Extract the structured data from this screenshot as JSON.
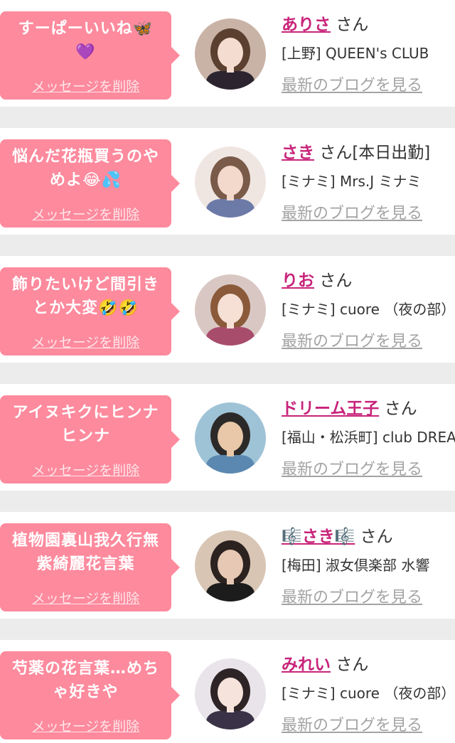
{
  "messages": [
    {
      "bubble": "すーぱーいいね🦋\n💜",
      "delete_label": "メッセージを削除",
      "cast_name": "ありさ",
      "honorific": "さん",
      "shop": "[上野] QUEEN's CLUB",
      "blog_link": "最新のブログを見る",
      "avatar_colors": {
        "bg": "#c9b3a6",
        "hair": "#5b4030",
        "skin": "#f4dcd0",
        "cloth": "#2c2530"
      }
    },
    {
      "bubble": "悩んだ花瓶買うのや\nめよ😂💦",
      "delete_label": "メッセージを削除",
      "cast_name": "さき",
      "honorific": "さん[本日出勤]",
      "shop": "[ミナミ] Mrs.J ミナミ",
      "blog_link": "最新のブログを見る",
      "avatar_colors": {
        "bg": "#efe6e2",
        "hair": "#7a5a48",
        "skin": "#f2d9cc",
        "cloth": "#6c7aa8"
      }
    },
    {
      "bubble": "飾りたいけど間引き\nとか大変🤣🤣",
      "delete_label": "メッセージを削除",
      "cast_name": "りお",
      "honorific": "さん",
      "shop": "[ミナミ] cuore （夜の部）",
      "blog_link": "最新のブログを見る",
      "avatar_colors": {
        "bg": "#d9c7c4",
        "hair": "#8a5a3a",
        "skin": "#f6e0d6",
        "cloth": "#a84c6c"
      }
    },
    {
      "bubble": "アイヌキクにヒンナ\nヒンナ",
      "delete_label": "メッセージを削除",
      "cast_name": "ドリーム王子",
      "honorific": "さん",
      "shop": "[福山・松浜町]  club DREAM",
      "blog_link": "最新のブログを見る",
      "avatar_colors": {
        "bg": "#9fc3d6",
        "hair": "#2c2a28",
        "skin": "#e8c8a8",
        "cloth": "#5a88b0"
      }
    },
    {
      "bubble": "植物園裏山我久行無\n紫綺麗花言葉",
      "delete_label": "メッセージを削除",
      "cast_name": "🎼さき🎼",
      "honorific": "さん",
      "shop": "[梅田] 淑女倶楽部 水響",
      "blog_link": "最新のブログを見る",
      "avatar_colors": {
        "bg": "#d8c5b4",
        "hair": "#2c2220",
        "skin": "#e6c8b4",
        "cloth": "#1c1c1c"
      }
    },
    {
      "bubble": "芍薬の花言葉…めち\nゃ好きや",
      "delete_label": "メッセージを削除",
      "cast_name": "みれい",
      "honorific": "さん",
      "shop": "[ミナミ] cuore （夜の部）",
      "blog_link": "最新のブログを見る",
      "avatar_colors": {
        "bg": "#e8e4ea",
        "hair": "#2e2426",
        "skin": "#f6e4dc",
        "cloth": "#3a3246"
      }
    }
  ]
}
